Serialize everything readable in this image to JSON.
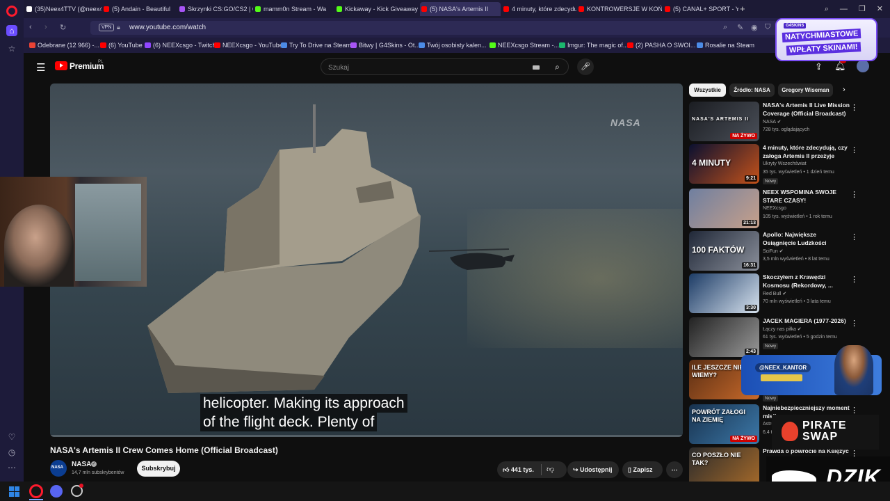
{
  "browser": {
    "tabs": [
      {
        "label": "(35)Neex4TTV (@neex4tt",
        "color": "#ffffff",
        "active": false
      },
      {
        "label": "(5) Andain - Beautiful",
        "color": "#ff0000",
        "active": false
      },
      {
        "label": "Skrzynki CS:GO/CS2 | G4S",
        "color": "#a855f7",
        "active": false
      },
      {
        "label": "mamm0n Stream - Wa",
        "color": "#53fc18",
        "active": false
      },
      {
        "label": "Kickaway - Kick Giveaway",
        "color": "#53fc18",
        "active": false
      },
      {
        "label": "(5) NASA's Artemis II",
        "color": "#ff0000",
        "active": true
      },
      {
        "label": "4 minuty, które zdecydują",
        "color": "#ff0000",
        "active": false
      },
      {
        "label": "KONTROWERSJE W KOŃC",
        "color": "#ff0000",
        "active": false
      },
      {
        "label": "(5) CANAL+ SPORT - YouT",
        "color": "#ff0000",
        "active": false
      }
    ],
    "new_tab": "+",
    "url": "www.youtube.com/watch",
    "vpn_label": "VPN",
    "bookmarks": [
      {
        "label": "Odebrane (12 966) -...",
        "color": "#ea4335"
      },
      {
        "label": "(6) YouTube",
        "color": "#ff0000"
      },
      {
        "label": "(6) NEEXcsgo - Twitch",
        "color": "#9146ff"
      },
      {
        "label": "NEEXcsgo - YouTube",
        "color": "#ff0000"
      },
      {
        "label": "Try To Drive na Steam",
        "color": "#4c8be6"
      },
      {
        "label": "Bitwy | G4Skins - Ot...",
        "color": "#a855f7"
      },
      {
        "label": "Twój osobisty kalen...",
        "color": "#4c8be6"
      },
      {
        "label": "NEEXcsgo Stream -...",
        "color": "#53fc18"
      },
      {
        "label": "Imgur: The magic of...",
        "color": "#1bb76e"
      },
      {
        "label": "(2) PASHA O SWOI...",
        "color": "#ff0000"
      },
      {
        "label": "Rosalie na Steam",
        "color": "#4c8be6"
      }
    ]
  },
  "youtube": {
    "logo_text": "Premium",
    "country": "PL",
    "search_placeholder": "Szukaj",
    "notification_count": "9+"
  },
  "video": {
    "title": "NASA's Artemis II Crew Comes Home (Official Broadcast)",
    "watermark": "NASA",
    "caption_line1": "helicopter. Making its approach",
    "caption_line2": "of the flight deck. Plenty of",
    "progress": 0.0,
    "channel": "NASA",
    "subscribers": "14,7 mln subskrybentów",
    "subscribe_label": "Subskrybuj",
    "likes": "441 tys.",
    "share_label": "Udostępnij",
    "save_label": "Zapisz"
  },
  "filters": [
    "Wszystkie",
    "Źródło: NASA",
    "Gregory Wiseman"
  ],
  "recommendations": [
    {
      "title": "NASA's Artemis II Live Mission Coverage (Official Broadcast)",
      "channel": "NASA",
      "verified": true,
      "meta": "728 tys. oglądających",
      "badge": "NA ŻYWO",
      "thumb_text": "NASA'S ARTEMIS II",
      "new": ""
    },
    {
      "title": "4 minuty, które zdecydują, czy załoga Artemis II przeżyje",
      "channel": "Ukryty Wszechświat",
      "verified": false,
      "meta": "35 tys. wyświetleń • 1 dzień temu",
      "duration": "9:21",
      "thumb_text": "4 MINUTY",
      "new": "Nowy"
    },
    {
      "title": "NEEX WSPOMINA SWOJE STARE CZASY!",
      "channel": "NEEXcsgo",
      "verified": false,
      "meta": "105 tys. wyświetleń • 1 rok temu",
      "duration": "21:13",
      "thumb_text": "",
      "new": ""
    },
    {
      "title": "Apollo: Największe Osiągnięcie Ludzkości",
      "channel": "SciFun",
      "verified": true,
      "meta": "3,5 mln wyświetleń • 8 lat temu",
      "duration": "16:31",
      "thumb_text": "100 FAKTÓW",
      "new": ""
    },
    {
      "title": "Skoczyłem z Krawędzi Kosmosu (Rekordowy, ...",
      "channel": "Red Bull",
      "verified": true,
      "meta": "70 mln wyświetleń • 3 lata temu",
      "duration": "3:30",
      "thumb_text": "",
      "new": ""
    },
    {
      "title": "JACEK MAGIERA (1977-2026)",
      "channel": "Łączy nas piłka",
      "verified": true,
      "meta": "61 tys. wyświetleń • 5 godzin temu",
      "duration": "2:43",
      "thumb_text": "",
      "new": "Nowy"
    },
    {
      "title": "",
      "channel": "",
      "verified": false,
      "meta": "",
      "thumb_text": "ILE JESZCZE NIE WIEMY?",
      "new": "Nowy"
    },
    {
      "title": "Najniebezpieczniejszy moment misji",
      "channel": "Astro",
      "verified": false,
      "meta": "6,4 tys.",
      "badge": "NA ŻYWO",
      "thumb_text": "POWRÓT ZAŁOGI NA ZIEMIĘ",
      "new": ""
    },
    {
      "title": "Prawda o powrocie na Księżyc",
      "channel": "",
      "verified": false,
      "meta": "",
      "thumb_text": "CO POSZŁO NIE TAK?",
      "new": ""
    }
  ],
  "overlays": {
    "g4_brand": "G4SKINS",
    "g4_line1": "NATYCHMIASTOWE",
    "g4_line2": "WPŁATY SKINAMI!",
    "kantor_handle": "@NEEX_KANTOR",
    "pirate_line1": "PIRATE",
    "pirate_line2": "SWAP",
    "dzik_text": "DZIK"
  }
}
